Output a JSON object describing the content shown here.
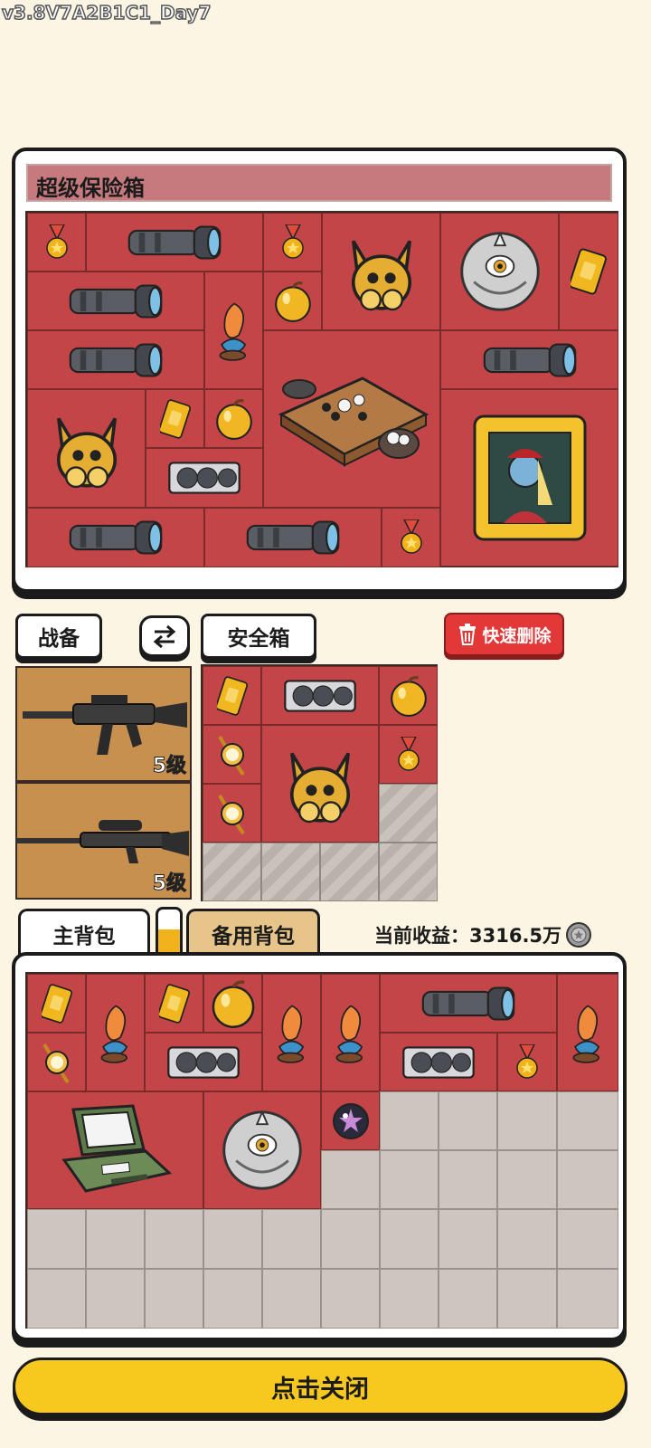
{
  "version_label": "v3.8V7A2B1C1_Day7",
  "vault": {
    "title": "超级保险箱"
  },
  "controls": {
    "equip_label": "战备",
    "swap_icon": "swap-arrows-icon",
    "safebox_label": "安全箱",
    "quick_delete_label": "快速删除"
  },
  "weapons": [
    {
      "name": "assault-rifle",
      "level": "5级"
    },
    {
      "name": "sniper-rifle",
      "level": "5级"
    }
  ],
  "tabs": {
    "main": "主背包",
    "backup": "备用背包"
  },
  "earnings": {
    "label": "当前收益：",
    "value": "3316.5万"
  },
  "close_button": "点击关闭",
  "colors": {
    "slot_red": "#c44548",
    "empty_gray": "#cdc6bf",
    "button_yellow": "#f7c81e",
    "delete_red": "#e23838"
  }
}
